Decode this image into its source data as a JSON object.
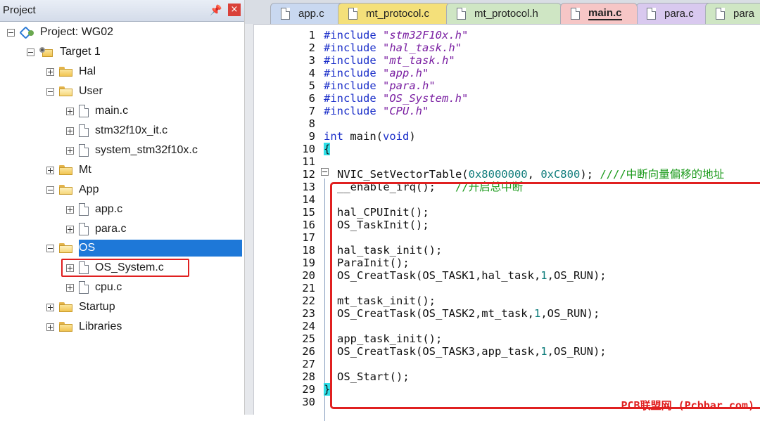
{
  "project": {
    "title": "Project",
    "pin_glyph": "📌",
    "close_glyph": "×",
    "tree": {
      "root": "Project: WG02",
      "target": "Target 1",
      "hal": "Hal",
      "user": "User",
      "main_c": "main.c",
      "stm32f10x_it_c": "stm32f10x_it.c",
      "system_stm32f10x_c": "system_stm32f10x.c",
      "mt": "Mt",
      "app": "App",
      "app_c": "app.c",
      "para_c": "para.c",
      "os": "OS",
      "os_system_c": "OS_System.c",
      "cpu_c": "cpu.c",
      "startup": "Startup",
      "libraries": "Libraries"
    }
  },
  "tabs": [
    {
      "label": "app.c",
      "color": "#c9d8f0"
    },
    {
      "label": "mt_protocol.c",
      "color": "#f4e07a"
    },
    {
      "label": "mt_protocol.h",
      "color": "#cfe6c4"
    },
    {
      "label": "main.c",
      "color": "#f6c6c6",
      "active": true
    },
    {
      "label": "para.c",
      "color": "#d9c9ef"
    },
    {
      "label": "para",
      "color": "#cfe6c4"
    }
  ],
  "code": {
    "line_numbers": [
      "1",
      "2",
      "3",
      "4",
      "5",
      "6",
      "7",
      "8",
      "9",
      "10",
      "11",
      "12",
      "13",
      "14",
      "15",
      "16",
      "17",
      "18",
      "19",
      "20",
      "21",
      "22",
      "23",
      "24",
      "25",
      "26",
      "27",
      "28",
      "29",
      "30"
    ],
    "inc_kw": "#include",
    "inc_files": [
      "\"stm32F10x.h\"",
      "\"hal_task.h\"",
      "\"mt_task.h\"",
      "\"app.h\"",
      "\"para.h\"",
      "\"OS_System.h\"",
      "\"CPU.h\""
    ],
    "l9_int": "int",
    "l9_main": " main(",
    "l9_void": "void",
    "l9_close": ")",
    "brace_open": "{",
    "brace_close": "}",
    "l12_fn": "NVIC_SetVectorTable(",
    "l12_a1": "0x8000000",
    "l12_sep": ", ",
    "l12_a2": "0xC800",
    "l12_end": "); ",
    "l12_cmt": "////中断向量偏移的地址",
    "l13_fn": "__enable_irq();   ",
    "l13_cmt": "//开启总中断",
    "l15": "hal_CPUInit();",
    "l16": "OS_TaskInit();",
    "l18": "hal_task_init();",
    "l19": "ParaInit();",
    "l20_a": "OS_CreatTask(OS_TASK1,hal_task,",
    "l20_n": "1",
    "l20_b": ",OS_RUN);",
    "l22": "mt_task_init();",
    "l23_a": "OS_CreatTask(OS_TASK2,mt_task,",
    "l23_n": "1",
    "l23_b": ",OS_RUN);",
    "l25": "app_task_init();",
    "l26_a": "OS_CreatTask(OS_TASK3,app_task,",
    "l26_n": "1",
    "l26_b": ",OS_RUN);",
    "l28": "OS_Start();"
  },
  "watermark": "PCB联盟网 (Pcbbar.com)",
  "colors": {
    "selection": "#1e78d8",
    "highlight_box": "#e02020",
    "brace_match": "#2fe0e8"
  }
}
